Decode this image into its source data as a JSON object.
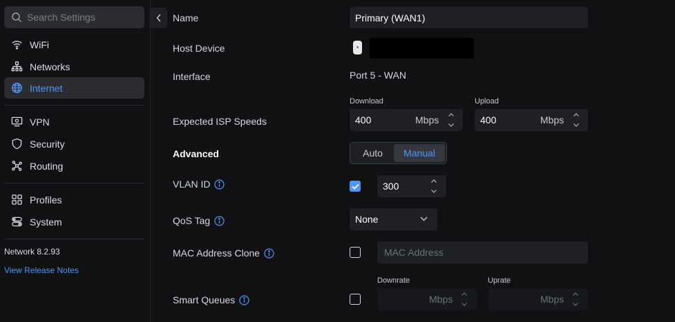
{
  "sidebar": {
    "search_placeholder": "Search Settings",
    "items": [
      {
        "label": "WiFi",
        "icon": "wifi-icon"
      },
      {
        "label": "Networks",
        "icon": "networks-icon"
      },
      {
        "label": "Internet",
        "icon": "globe-icon",
        "active": true
      },
      {
        "label": "VPN",
        "icon": "vpn-icon"
      },
      {
        "label": "Security",
        "icon": "shield-icon"
      },
      {
        "label": "Routing",
        "icon": "routing-icon"
      },
      {
        "label": "Profiles",
        "icon": "profiles-icon"
      },
      {
        "label": "System",
        "icon": "system-icon"
      }
    ],
    "version": "Network 8.2.93",
    "release_notes": "View Release Notes"
  },
  "form": {
    "name": {
      "label": "Name",
      "value": "Primary (WAN1)"
    },
    "host_device": {
      "label": "Host Device"
    },
    "interface": {
      "label": "Interface",
      "value": "Port 5 - WAN"
    },
    "isp_speeds": {
      "label": "Expected ISP Speeds",
      "download_label": "Download",
      "download_value": "400",
      "upload_label": "Upload",
      "upload_value": "400",
      "unit": "Mbps"
    },
    "advanced": {
      "label": "Advanced",
      "options": [
        "Auto",
        "Manual"
      ],
      "selected": "Manual"
    },
    "vlan_id": {
      "label": "VLAN ID",
      "checked": true,
      "value": "300"
    },
    "qos_tag": {
      "label": "QoS Tag",
      "value": "None"
    },
    "mac_clone": {
      "label": "MAC Address Clone",
      "checked": false,
      "placeholder": "MAC Address"
    },
    "smart_queues": {
      "label": "Smart Queues",
      "checked": false,
      "downrate_label": "Downrate",
      "uprate_label": "Uprate",
      "unit": "Mbps"
    }
  },
  "colors": {
    "accent": "#4f97f7",
    "background": "#101113",
    "field": "#1e2023"
  }
}
